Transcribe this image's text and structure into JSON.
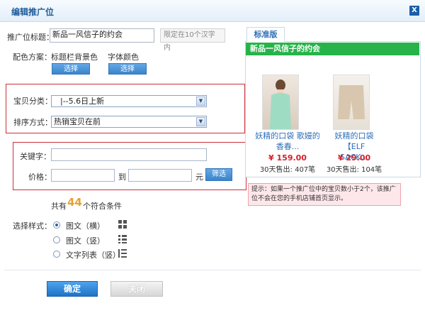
{
  "dialog": {
    "title": "编辑推广位",
    "close_label": "X"
  },
  "form": {
    "title_label": "推广位标题：",
    "title_value": "新品一风信子的约会",
    "title_hint": "限定在10个汉字内",
    "color_label": "配色方案：",
    "titlebar_bg_label": "标题栏背景色",
    "font_color_label": "字体颜色",
    "select_btn_1": "选择",
    "select_btn_2": "选择",
    "category_label": "宝贝分类：",
    "category_value": "|--5.6日上新",
    "sort_label": "排序方式：",
    "sort_value": "热销宝贝在前",
    "keyword_label": "关键字：",
    "keyword_value": "",
    "price_label": "价格：",
    "price_to": "到",
    "price_unit": "元",
    "filter_btn": "筛选",
    "result_prefix": "共有",
    "result_count": "44",
    "result_suffix": "个符合条件",
    "style_label": "选择样式：",
    "styles": [
      {
        "label": "图文（横）",
        "selected": true,
        "icon": "grid-horizontal-icon"
      },
      {
        "label": "图文（竖）",
        "selected": false,
        "icon": "list-vertical-icon"
      },
      {
        "label": "文字列表（竖）",
        "selected": false,
        "icon": "text-list-icon"
      }
    ],
    "ok_btn": "确定",
    "close_btn": "关闭"
  },
  "preview": {
    "tab_label": "标准版",
    "header_title": "新品一风信子的约会",
    "header_color": "#27b34a",
    "products": [
      {
        "title_line1": "妖精的口袋 歌嫚的",
        "title_line2": "香春...",
        "price": "¥ 159.00",
        "sold": "30天售出: 407笔"
      },
      {
        "title_line1": "妖精的口袋【ELF",
        "title_line2": "SACK...",
        "price": "¥ 29.00",
        "sold": "30天售出: 104笔"
      }
    ],
    "notice": "提示：如果一个推广位中的宝贝数小于2个，该推广位不会在您的手机店铺首页显示。"
  },
  "colors": {
    "accent": "#2e7bc8",
    "red_border": "#c8313b",
    "price": "#d4202a",
    "count": "#e8a030"
  }
}
